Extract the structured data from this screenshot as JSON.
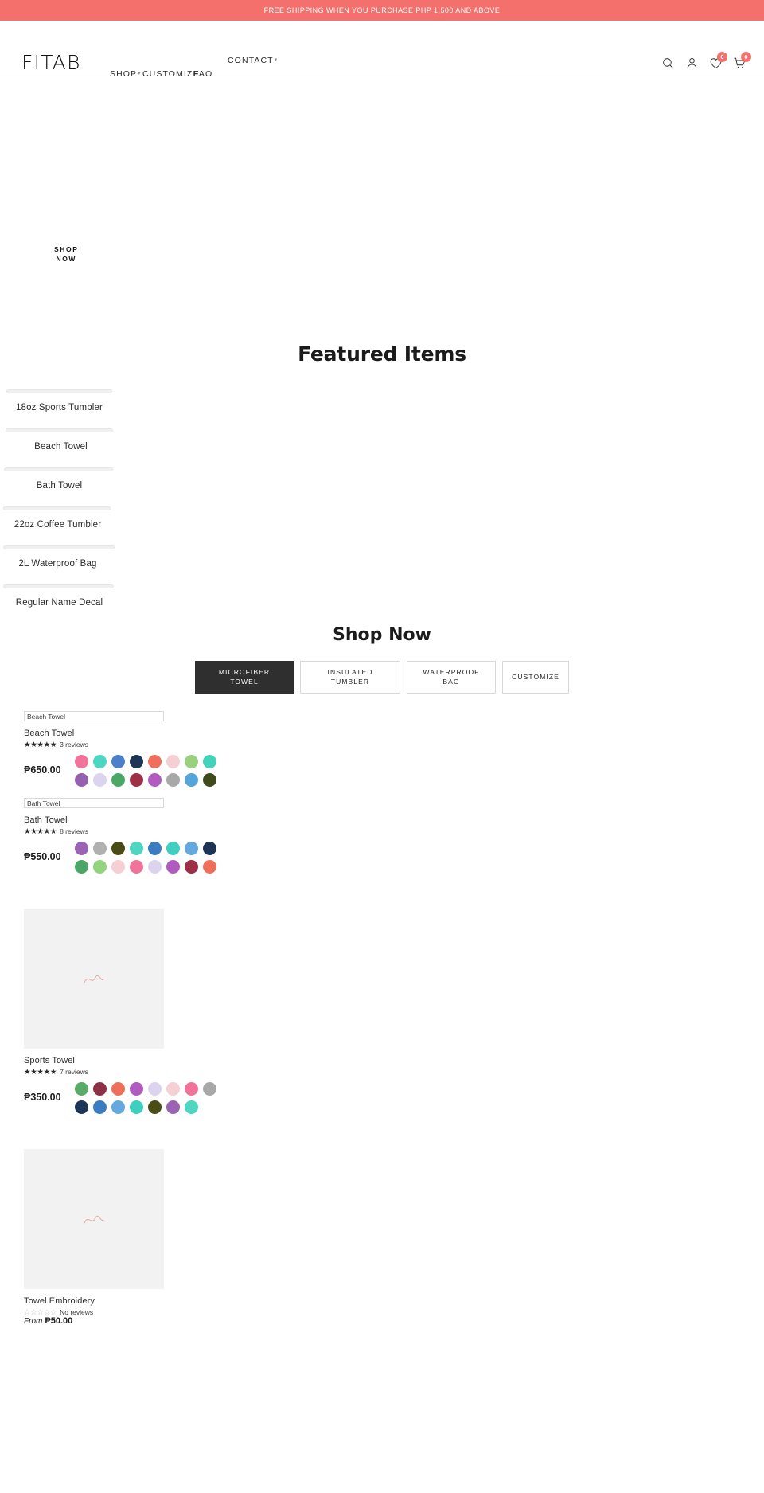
{
  "announcement": {
    "text": "FREE SHIPPING WHEN YOU PURCHASE PHP 1,500 AND ABOVE",
    "bg": "#f4706d",
    "color": "#ffffff"
  },
  "header": {
    "logo": "FITAB",
    "nav": [
      {
        "label": "SHOP",
        "has_caret": true
      },
      {
        "label": "CUSTOMIZE",
        "has_caret": false
      },
      {
        "label": "FAQ",
        "has_caret": false
      },
      {
        "label": "CONTACT",
        "has_caret": true
      }
    ],
    "nav_overflow": "...",
    "icons": [
      {
        "name": "search-icon",
        "badge": null
      },
      {
        "name": "account-icon",
        "badge": null
      },
      {
        "name": "wishlist-heart-icon",
        "badge": "0"
      },
      {
        "name": "cart-icon",
        "badge": "0"
      }
    ],
    "badge_color": "#f4706d"
  },
  "hero": {
    "cta_label": "SHOP\nNOW"
  },
  "featured": {
    "title": "Featured Items",
    "items": [
      {
        "label": "18oz Sports Tumbler"
      },
      {
        "label": "Beach Towel"
      },
      {
        "label": "Bath Towel"
      },
      {
        "label": "22oz Coffee Tumbler"
      },
      {
        "label": "2L Waterproof Bag"
      },
      {
        "label": "Regular Name Decal"
      }
    ]
  },
  "shop": {
    "title": "Shop Now",
    "tabs": [
      {
        "label": "MICROFIBER\nTOWEL",
        "active": true
      },
      {
        "label": "INSULATED\nTUMBLER",
        "active": false
      },
      {
        "label": "WATERPROOF\nBAG",
        "active": false
      },
      {
        "label": "CUSTOMIZE",
        "active": false
      }
    ],
    "products": [
      {
        "alt_text": "Beach Towel",
        "name": "Beach Towel",
        "stars": "★★★★★",
        "rating_filled": true,
        "reviews": "3 reviews",
        "price": "₱650.00",
        "price_prefix": "",
        "image_placeholder": false,
        "swatch_rows": [
          [
            "#f2739a",
            "#4ed6c0",
            "#4b7fc9",
            "#1d3557",
            "#ef6f5a",
            "#f5cfd3",
            "#9ad17e",
            "#44d2bc"
          ],
          [
            "#9361b0",
            "#dcd3ef",
            "#4aa766",
            "#9e2f46",
            "#b15bc0",
            "#a8a8a8",
            "#55a5d8",
            "#3f4a1d"
          ]
        ]
      },
      {
        "alt_text": "Bath Towel",
        "name": "Bath Towel",
        "stars": "★★★★★",
        "rating_filled": true,
        "reviews": "8 reviews",
        "price": "₱550.00",
        "price_prefix": "",
        "image_placeholder": false,
        "swatch_rows": [
          [
            "#9a63b4",
            "#b0b0b0",
            "#4a4c15",
            "#4ed6c0",
            "#3a7cc2",
            "#3ecfc0",
            "#63a9dd",
            "#1d3557"
          ],
          [
            "#4aa766",
            "#93d47f",
            "#f5cfd3",
            "#f2739a",
            "#dcd3ef",
            "#b15bc0",
            "#9e2f46",
            "#ef6f5a"
          ]
        ]
      },
      {
        "alt_text": "",
        "name": "Sports Towel",
        "stars": "★★★★★",
        "rating_filled": true,
        "reviews": "7 reviews",
        "price": "₱350.00",
        "price_prefix": "",
        "image_placeholder": true,
        "swatch_rows": [
          [
            "#59ab68",
            "#8e3146",
            "#ef6f5a",
            "#b15bc0",
            "#dcd3ef",
            "#f5cfd3",
            "#f2739a",
            "#a8a8a8"
          ],
          [
            "#1d3557",
            "#3a7cc2",
            "#63a9dd",
            "#3ecfc0",
            "#4a4c15",
            "#9a63b4",
            "#4ed6c0"
          ]
        ]
      },
      {
        "alt_text": "",
        "name": "Towel Embroidery",
        "stars": "☆☆☆☆☆",
        "rating_filled": false,
        "reviews": "No reviews",
        "price": "₱50.00",
        "price_prefix": "From",
        "image_placeholder": true,
        "swatch_rows": []
      }
    ]
  }
}
